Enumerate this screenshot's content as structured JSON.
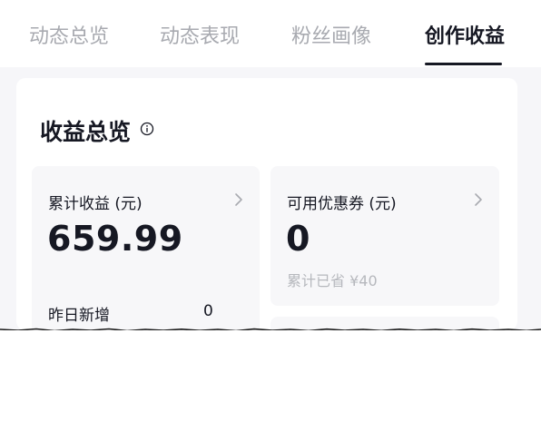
{
  "tabs": [
    {
      "label": "动态总览"
    },
    {
      "label": "动态表现"
    },
    {
      "label": "粉丝画像"
    },
    {
      "label": "创作收益"
    }
  ],
  "active_tab": "创作收益",
  "panel": {
    "title": "收益总览",
    "info_icon": "info-icon"
  },
  "cards": {
    "earnings": {
      "label": "累计收益 (元)",
      "value": "659.99",
      "row_label": "昨日新增",
      "row_value": "0"
    },
    "coupons": {
      "label": "可用优惠券 (元)",
      "value": "0",
      "sub": "累计已省 ¥40"
    }
  },
  "colors": {
    "text_primary": "#161823",
    "text_muted": "#a8aab0",
    "card_bg": "#f7f7f9",
    "page_bg": "#f6f6f9"
  }
}
